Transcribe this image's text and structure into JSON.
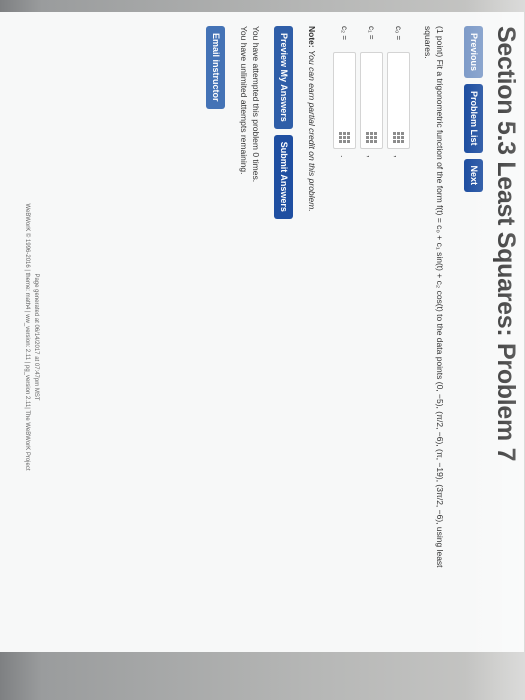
{
  "page": {
    "title": "Section 5.3 Least Squares: Problem 7"
  },
  "nav": {
    "previous": "Previous",
    "problem_list": "Problem List",
    "next": "Next"
  },
  "problem": {
    "points": "(1 point)",
    "statement": "Fit a trigonometric function of the form f(t) = c₀ + c₁ sin(t) + c₂ cos(t) to the data points (0, −5), (π/2, −6), (π, −19), (3π/2, −6), using least squares."
  },
  "answers": [
    {
      "label": "c₀ =",
      "value": "",
      "suffix": ","
    },
    {
      "label": "c₁ =",
      "value": "",
      "suffix": ","
    },
    {
      "label": "c₂ =",
      "value": "",
      "suffix": "."
    }
  ],
  "note": {
    "label": "Note:",
    "text": "You can earn partial credit on this problem."
  },
  "actions": {
    "preview": "Preview My Answers",
    "submit": "Submit Answers"
  },
  "status": {
    "line1": "You have attempted this problem 0 times.",
    "line2": "You have unlimited attempts remaining."
  },
  "email": {
    "label": "Email instructor"
  },
  "footer": {
    "generated": "Page generated at 06/14/2017 at 07:47pm MST",
    "version": "WeBWorK © 1996-2016 | theme: math4 | ww_version: 2.11 | pg_version 2.11| The WeBWorK Project"
  },
  "colors": {
    "primary_button": "#1f4fa1",
    "light_button": "#7f9cc9",
    "page_bg": "#f7f8f8",
    "photo_bg": "#8a8c8d"
  }
}
